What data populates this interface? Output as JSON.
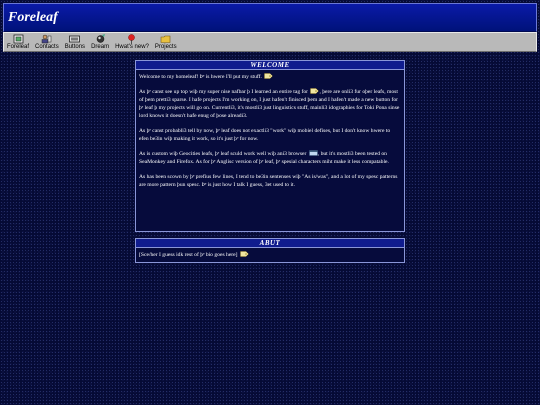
{
  "banner": {
    "title": "Foreleaf"
  },
  "toolbar": {
    "items": [
      {
        "label": "Foreleaf",
        "icon": "home-icon"
      },
      {
        "label": "Contacts",
        "icon": "contacts-icon"
      },
      {
        "label": "Buttons",
        "icon": "buttons-icon"
      },
      {
        "label": "Dream",
        "icon": "dream-icon"
      },
      {
        "label": "Hwat's new?",
        "icon": "pushpin-icon"
      },
      {
        "label": "Projects",
        "icon": "folder-icon"
      }
    ]
  },
  "welcome": {
    "heading": "WELCOME",
    "p1": "Welcome to my homeleaf! Þᵉ is hwere I'll put my stuff.",
    "p2a": "As þᵉ canst see up top wiþ my super nise nafbar þ I learned an entire tag for",
    "p2b": ", þere are onli3 fur oþer leafs, most of þem pretti3 sparse. I hafe projects I'm working on, I just hafen't finisced þem and I hafen't made a new button for þᵉ leaf þ my projects will go on. Currentli3, it's mostli3 just linguistics stuff, mainli3 idographies for Toki Pona sinse lord knows it doesn't hafe enug of þose alreadi3.",
    "p3": "As þᵉ canst probabli3 tell by now, þᵉ leaf does not exactli3 \"work\" wiþ mobiel defises, but I don't know hwere to efen be3in wiþ making it work, so it's just þᵉ for now.",
    "p4a": "As is custom wiþ Geocities leafs, þᵉ leaf sculd work well wiþ ani3 browser",
    "p4b": ", but it's mostli3 been tested on SeaMonkey and Firefox. As for þᵉ Anglisc version of þᵉ leaf, þᵉ spesial characters miht make it less compatable.",
    "p5": "As has been scown by þᵉ prefius few lines, I tend to be3in sentenses wiþ \"As is/was\", and a lot of my spesc patterns are more pattern þun spesc. Þᵉ is just how I talk I guess, 3et used to it."
  },
  "abut": {
    "heading": "ABUT",
    "text": "[Sce/her I guess idk rest of þᵉ bio goes here]"
  },
  "colors": {
    "banner": "#00127a",
    "toolbar": "#b9b9b9",
    "background": "#050a35",
    "panel_border": "#8a96d8"
  }
}
